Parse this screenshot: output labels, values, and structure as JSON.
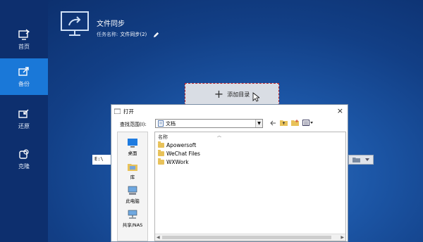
{
  "sidebar": {
    "items": [
      {
        "label": "首页",
        "icon": "home-monitor-icon"
      },
      {
        "label": "备份",
        "icon": "backup-icon",
        "active": true
      },
      {
        "label": "还原",
        "icon": "restore-icon"
      },
      {
        "label": "克隆",
        "icon": "clone-icon"
      }
    ]
  },
  "task": {
    "title": "文件同步",
    "name_label": "任务名称:",
    "name_value": "文件同步(2)"
  },
  "add_directory": {
    "label": "添加目录"
  },
  "path_field": {
    "value": "E:\\"
  },
  "dialog": {
    "title": "打开",
    "close": "×",
    "look_in_label": "查找范围(I):",
    "look_in_value": "文档",
    "column_name": "名称",
    "places": [
      {
        "label": "桌面",
        "icon": "desktop-icon"
      },
      {
        "label": "库",
        "icon": "library-icon"
      },
      {
        "label": "此电脑",
        "icon": "computer-icon"
      },
      {
        "label": "共享/NAS",
        "icon": "network-icon"
      }
    ],
    "files": [
      "Apowersoft",
      "WeChat Files",
      "WXWork"
    ]
  },
  "colors": {
    "sidebar_bg": "#0d2f6e",
    "active_item": "#1a78d8",
    "add_dir_border": "#b8202a"
  }
}
